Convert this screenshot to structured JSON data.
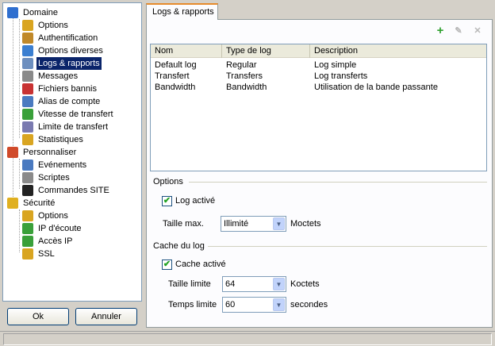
{
  "tree": {
    "items": [
      {
        "label": "Domaine",
        "icon": "domain-icon",
        "color": "#2f6fcf"
      },
      {
        "label": "Options",
        "icon": "options-icon",
        "color": "#d9a521"
      },
      {
        "label": "Authentification",
        "icon": "key-user-icon",
        "color": "#c0892a"
      },
      {
        "label": "Options diverses",
        "icon": "misc-options-icon",
        "color": "#3b7fd1"
      },
      {
        "label": "Logs & rapports",
        "icon": "logs-icon",
        "color": "#6d8fbf"
      },
      {
        "label": "Messages",
        "icon": "messages-icon",
        "color": "#8a8a8a"
      },
      {
        "label": "Fichiers bannis",
        "icon": "banned-files-icon",
        "color": "#c83232"
      },
      {
        "label": "Alias de compte",
        "icon": "alias-icon",
        "color": "#4a7ac0"
      },
      {
        "label": "Vitesse de transfert",
        "icon": "speed-icon",
        "color": "#3aa03a"
      },
      {
        "label": "Limite de transfert",
        "icon": "limit-icon",
        "color": "#7a7ab0"
      },
      {
        "label": "Statistiques",
        "icon": "stats-icon",
        "color": "#d9a521"
      },
      {
        "label": "Personnaliser",
        "icon": "customize-icon",
        "color": "#d04a2a"
      },
      {
        "label": "Evénements",
        "icon": "events-icon",
        "color": "#4a7ac0"
      },
      {
        "label": "Scriptes",
        "icon": "scripts-icon",
        "color": "#8a8a8a"
      },
      {
        "label": "Commandes SITE",
        "icon": "terminal-icon",
        "color": "#222222"
      },
      {
        "label": "Sécurité",
        "icon": "security-icon",
        "color": "#e0b020"
      },
      {
        "label": "Options",
        "icon": "options-icon",
        "color": "#d9a521"
      },
      {
        "label": "IP d'écoute",
        "icon": "ip-listen-icon",
        "color": "#3aa03a"
      },
      {
        "label": "Accès IP",
        "icon": "ip-access-icon",
        "color": "#3aa03a"
      },
      {
        "label": "SSL",
        "icon": "ssl-key-icon",
        "color": "#d9a521"
      }
    ]
  },
  "buttons": {
    "ok": "Ok",
    "cancel": "Annuler"
  },
  "tab": {
    "label": "Logs & rapports"
  },
  "toolbar": {
    "add": "+",
    "edit": "✎",
    "delete": "✕"
  },
  "table": {
    "columns": [
      "Nom",
      "Type de log",
      "Description"
    ],
    "rows": [
      [
        "Default log",
        "Regular",
        "Log simple"
      ],
      [
        "Transfert",
        "Transfers",
        "Log transferts"
      ],
      [
        "Bandwidth",
        "Bandwidth",
        "Utilisation de la bande passante"
      ]
    ]
  },
  "options": {
    "title": "Options",
    "log_enabled_label": "Log activé",
    "log_enabled": true,
    "max_size_label": "Taille max.",
    "max_size_value": "Illimité",
    "max_size_unit": "Moctets"
  },
  "cache": {
    "title": "Cache du log",
    "enabled_label": "Cache activé",
    "enabled": true,
    "size_label": "Taille limite",
    "size_value": "64",
    "size_unit": "Koctets",
    "time_label": "Temps limite",
    "time_value": "60",
    "time_unit": "secondes"
  }
}
